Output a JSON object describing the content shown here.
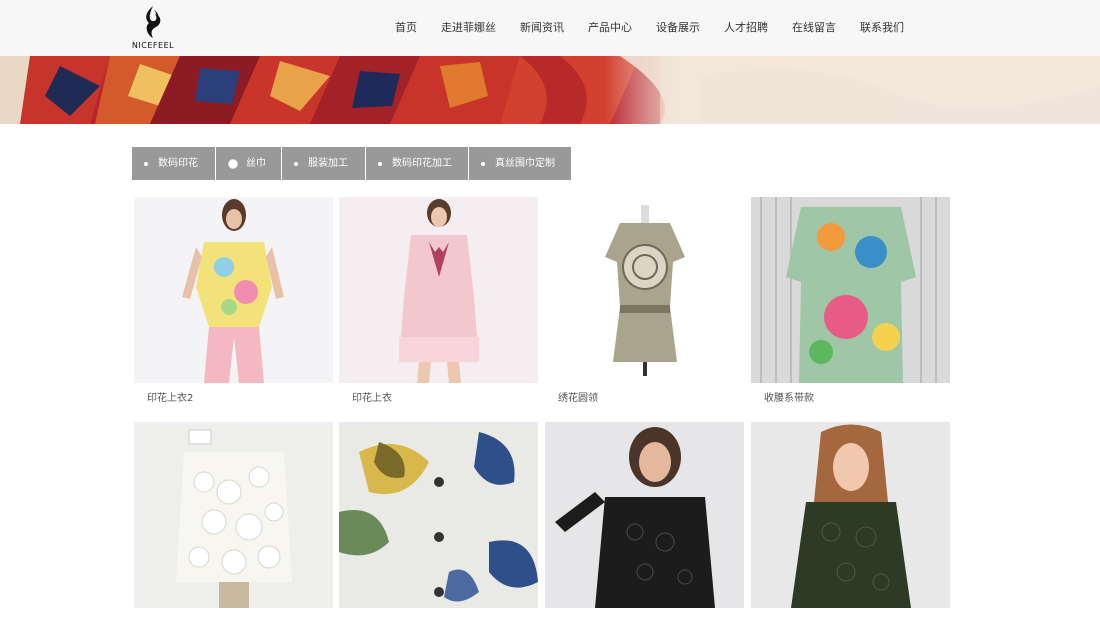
{
  "logo": {
    "text": "NICEFEEL",
    "icon": "flame-swirl-logo-icon"
  },
  "nav": {
    "items": [
      {
        "label": "首页"
      },
      {
        "label": "走进菲娜丝"
      },
      {
        "label": "新闻资讯"
      },
      {
        "label": "产品中心"
      },
      {
        "label": "设备展示"
      },
      {
        "label": "人才招聘"
      },
      {
        "label": "在线留言"
      },
      {
        "label": "联系我们"
      }
    ]
  },
  "tabs": {
    "items": [
      {
        "label": "数码印花",
        "active": false
      },
      {
        "label": "丝巾",
        "active": true
      },
      {
        "label": "服装加工",
        "active": false
      },
      {
        "label": "数码印花加工",
        "active": false
      },
      {
        "label": "真丝围巾定制",
        "active": false
      }
    ]
  },
  "products": {
    "items": [
      {
        "caption": "印花上衣2"
      },
      {
        "caption": "印花上衣"
      },
      {
        "caption": "绣花圆领"
      },
      {
        "caption": "收腰系带款"
      },
      {
        "caption": ""
      },
      {
        "caption": ""
      },
      {
        "caption": ""
      },
      {
        "caption": ""
      }
    ]
  },
  "colors": {
    "header_bg": "#f7f7f7",
    "tab_bg": "#999999",
    "banner_red": "#c0392b"
  }
}
